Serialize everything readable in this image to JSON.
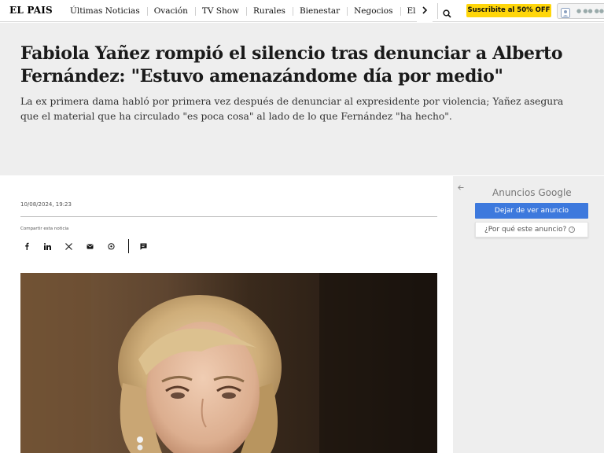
{
  "header": {
    "logo": "EL PAIS",
    "nav_items": [
      "Últimas Noticias",
      "Ovación",
      "TV Show",
      "Rurales",
      "Bienestar",
      "Negocios",
      "El Pa"
    ],
    "more_icon": "chevron-right-icon",
    "search_icon": "search-icon",
    "subscribe_label": "Suscribite al 50% OFF",
    "subscribe_color": "#ffd60a"
  },
  "article": {
    "headline": "Fabiola Yañez rompió el silencio tras denunciar a Alberto Fernández: \"Estuvo amenazándome día por medio\"",
    "deck": "La ex primera dama habló por primera vez después de denunciar al expresidente por violencia; Yañez asegura que el material que ha circulado \"es poca cosa\" al lado de lo que Fernández \"ha hecho\".",
    "date": "10/08/2024, 19:23",
    "share_label": "Compartir esta noticia",
    "share_icons": [
      "facebook-icon",
      "linkedin-icon",
      "x-icon",
      "email-icon",
      "whatsapp-icon",
      "comment-icon"
    ]
  },
  "ad": {
    "back_icon": "back-arrow-icon",
    "brand": "Anuncios Google",
    "stop_label": "Dejar de ver anuncio",
    "why_label": "¿Por qué este anuncio?",
    "accent": "#3d79dd"
  }
}
